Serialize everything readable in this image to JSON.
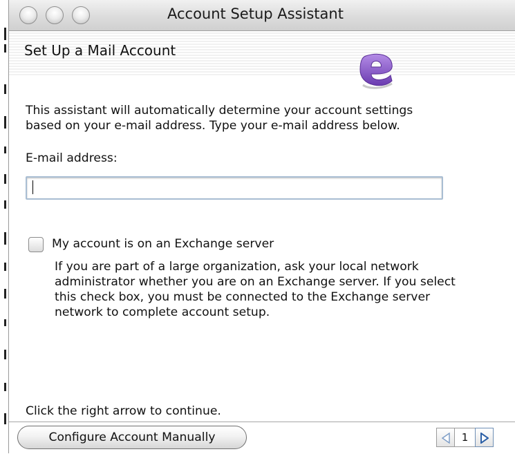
{
  "window": {
    "title": "Account Setup Assistant"
  },
  "header": {
    "title": "Set Up a Mail Account",
    "logo_icon": "entourage-e-icon",
    "logo_color": "#8a5cc7"
  },
  "content": {
    "intro_line1": "This assistant will automatically determine your account settings",
    "intro_line2": "based on your e-mail address. Type your e-mail address below.",
    "email_label": "E-mail address:",
    "email_value": "",
    "exchange_checkbox_label": "My account is on an Exchange server",
    "exchange_checked": false,
    "help_line1": "If you are part of a large organization, ask your local network",
    "help_line2": "administrator whether you are on an Exchange server. If you select",
    "help_line3": "this check box, you must be connected to the Exchange server",
    "help_line4": "network to complete account setup.",
    "continue_text": "Click the right arrow to continue."
  },
  "footer": {
    "manual_button_label": "Configure Account Manually",
    "page_number": "1",
    "prev_icon": "triangle-left-icon",
    "next_icon": "triangle-right-icon",
    "next_icon_color": "#2b5fa6",
    "prev_icon_color": "#7f9ec7"
  }
}
